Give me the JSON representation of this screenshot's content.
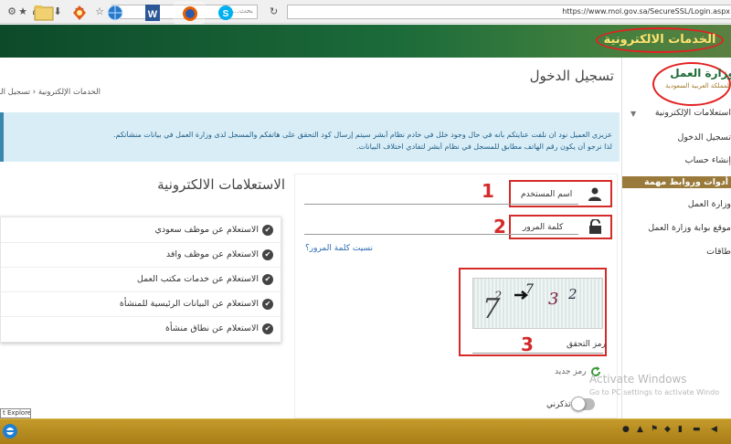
{
  "browser": {
    "search_placeholder": "بحث...",
    "url": "https://www.mol.gov.sa/SecureSSL/Login.aspx"
  },
  "header": {
    "eservices_label": "الخدمات الالكترونية"
  },
  "sidebar": {
    "logo_title": "وزارة العمل",
    "logo_subtitle": "المملكة العربية السعودية",
    "items": [
      {
        "label": "استعلامات الإلكترونية"
      },
      {
        "label": "تسجيل الدخول"
      },
      {
        "label": "إنشاء حساب"
      },
      {
        "label": "أدوات وروابط مهمة"
      },
      {
        "label": "وزارة العمل"
      },
      {
        "label": "موقع بوابة وزارة العمل"
      },
      {
        "label": "طاقات"
      }
    ]
  },
  "main": {
    "page_title": "تسجيل الدخول",
    "breadcrumb": "الخدمات الإلكترونية ‹ تسجيل الدخول",
    "alert_line1": "عزيزي العميل نود ان نلفت عنايتكم بأنه في حال وجود خلل في خادم نظام أبشر سيتم إرسال كود التحقق على هاتفكم والمسجل لدى وزارة العمل في بيانات منشأتكم.",
    "alert_line2": "لذا نرجو أن يكون رقم الهاتف مطابق للمسجل في نظام أبشر لتفادي اختلاف البيانات."
  },
  "login": {
    "username_label": "اسم المستخدم",
    "password_label": "كلمة المرور",
    "forgot_link": "نسيت كلمة المرور؟",
    "captcha_label": "رمز التحقق",
    "captcha_chars": [
      "7",
      "2",
      "7",
      "3",
      "2"
    ],
    "new_code_label": "رمز جديد",
    "remember_label": "تذكرني",
    "annotations": [
      "1",
      "2",
      "3"
    ]
  },
  "inquiries": {
    "title": "الاستعلامات الالكترونية",
    "items": [
      {
        "label": "الاستعلام عن موظف سعودي"
      },
      {
        "label": "الاستعلام عن موظف وافد"
      },
      {
        "label": "الاستعلام عن خدمات مكتب العمل"
      },
      {
        "label": "الاستعلام عن البيانات الرئيسية للمنشأة"
      },
      {
        "label": "الاستعلام عن نطاق منشأة"
      }
    ]
  },
  "os": {
    "ie_tooltip": "t Explorer",
    "watermark_line1": "Activate Windows",
    "watermark_line2": "Go to PC settings to activate Windo"
  },
  "colors": {
    "header_green": "#1c6b3a",
    "accent_gold": "#9a7a3a",
    "annotation_red": "#d42a2a",
    "alert_blue": "#d9edf7",
    "taskbar": "#b8891f"
  }
}
